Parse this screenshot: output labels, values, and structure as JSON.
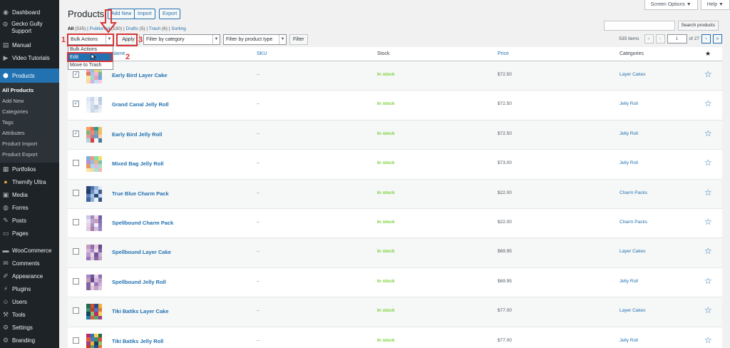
{
  "sidebar": {
    "items": [
      {
        "label": "Dashboard",
        "icon": "dashboard-icon"
      },
      {
        "label": "Gecko Gully Support",
        "icon": "gear-icon"
      },
      {
        "label": "Manual",
        "icon": "book-icon"
      },
      {
        "label": "Video Tutorials",
        "icon": "video-icon"
      },
      {
        "label": "Products",
        "icon": "products-icon"
      },
      {
        "label": "Portfolios",
        "icon": "portfolio-icon"
      },
      {
        "label": "Themify Ultra",
        "icon": "themify-icon"
      },
      {
        "label": "Media",
        "icon": "media-icon"
      },
      {
        "label": "Forms",
        "icon": "forms-icon"
      },
      {
        "label": "Posts",
        "icon": "pin-icon"
      },
      {
        "label": "Pages",
        "icon": "pages-icon"
      },
      {
        "label": "WooCommerce",
        "icon": "woocommerce-icon"
      },
      {
        "label": "Comments",
        "icon": "comment-icon"
      },
      {
        "label": "Appearance",
        "icon": "brush-icon"
      },
      {
        "label": "Plugins",
        "icon": "plugin-icon"
      },
      {
        "label": "Users",
        "icon": "user-icon"
      },
      {
        "label": "Tools",
        "icon": "wrench-icon"
      },
      {
        "label": "Settings",
        "icon": "settings-icon"
      },
      {
        "label": "Branding",
        "icon": "branding-icon"
      }
    ],
    "submenu": [
      "All Products",
      "Add New",
      "Categories",
      "Tags",
      "Attributes",
      "Product Import",
      "Product Export"
    ]
  },
  "header": {
    "title": "Products",
    "add_new": "Add New",
    "import": "Import",
    "export": "Export",
    "screen_options": "Screen Options ▼",
    "help": "Help ▼"
  },
  "views": {
    "all": "All",
    "all_count": "(535)",
    "published": "Published",
    "published_count": "(530)",
    "drafts": "Drafts",
    "drafts_count": "(5)",
    "trash": "Trash",
    "trash_count": "(6)",
    "sorting": "Sorting"
  },
  "search": {
    "button": "Search products"
  },
  "tablenav": {
    "bulk_actions": "Bulk Actions",
    "apply": "Apply",
    "filter_category": "Filter by category",
    "filter_type": "Filter by product type",
    "filter_btn": "Filter",
    "dropdown_options": [
      "Bulk Actions",
      "Edit",
      "Move to Trash"
    ],
    "items_count": "535 items",
    "page_current": "1",
    "page_total": "of 27",
    "first": "«",
    "prev": "‹",
    "next": "›",
    "last": "»"
  },
  "annotations": {
    "n1": "1",
    "n2": "2",
    "n3": "3"
  },
  "columns": {
    "name": "Name",
    "sku": "SKU",
    "stock": "Stock",
    "price": "Price",
    "categories": "Categories",
    "featured": "★"
  },
  "rows": [
    {
      "name": "Early Bird Layer Cake",
      "sku": "–",
      "stock": "In stock",
      "price": "$72.50",
      "category": "Layer Cakes",
      "checked": true
    },
    {
      "name": "Grand Canal Jelly Roll",
      "sku": "–",
      "stock": "In stock",
      "price": "$72.50",
      "category": "Jelly Roll",
      "checked": true
    },
    {
      "name": "Early Bird Jelly Roll",
      "sku": "–",
      "stock": "In stock",
      "price": "$72.50",
      "category": "Jelly Roll",
      "checked": true
    },
    {
      "name": "Mixed Bag Jelly Roll",
      "sku": "–",
      "stock": "In stock",
      "price": "$73.00",
      "category": "Jelly Roll",
      "checked": false
    },
    {
      "name": "True Blue Charm Pack",
      "sku": "–",
      "stock": "In stock",
      "price": "$22.00",
      "category": "Charm Packs",
      "checked": false
    },
    {
      "name": "Spellbound Charm Pack",
      "sku": "–",
      "stock": "In stock",
      "price": "$22.00",
      "category": "Charm Packs",
      "checked": false
    },
    {
      "name": "Spellbound Layer Cake",
      "sku": "–",
      "stock": "In stock",
      "price": "$69.95",
      "category": "Layer Cakes",
      "checked": false
    },
    {
      "name": "Spellbound Jelly Roll",
      "sku": "–",
      "stock": "In stock",
      "price": "$69.95",
      "category": "Jelly Roll",
      "checked": false
    },
    {
      "name": "Tiki Batiks Layer Cake",
      "sku": "–",
      "stock": "In stock",
      "price": "$77.00",
      "category": "Layer Cakes",
      "checked": false
    },
    {
      "name": "Tiki Batiks Jelly Roll",
      "sku": "–",
      "stock": "In stock",
      "price": "$77.00",
      "category": "Jelly Roll",
      "checked": false
    }
  ],
  "colors": {
    "accent": "#2271b1",
    "sidebar": "#1d2327",
    "instock": "#7ad03a",
    "annotation": "#d63638"
  }
}
